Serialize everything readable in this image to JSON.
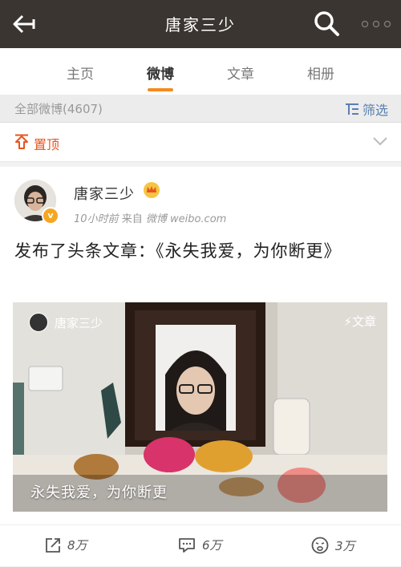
{
  "header": {
    "title": "唐家三少"
  },
  "tabs": [
    {
      "label": "主页"
    },
    {
      "label": "微博"
    },
    {
      "label": "文章"
    },
    {
      "label": "相册"
    }
  ],
  "filterbar": {
    "count_label": "全部微博(4607)",
    "filter_label": "筛选"
  },
  "pinned": {
    "label": "置顶"
  },
  "post": {
    "author": "唐家三少",
    "time": "10小时前",
    "source_prefix": "来自",
    "source": "微博 weibo.com",
    "text": "发布了头条文章：《永失我爱，为你断更》",
    "article": {
      "author": "唐家三少",
      "tag": "文章",
      "title": "永失我爱，为你断更"
    },
    "actions": {
      "share": "8万",
      "comment": "6万",
      "like": "3万"
    }
  },
  "colors": {
    "header_bg": "#3a3530",
    "accent": "#f58a1f",
    "pin_red": "#e8541e",
    "link_blue": "#5a7fb0"
  },
  "icons": [
    "back-arrow-icon",
    "search-icon",
    "more-icon",
    "pin-icon",
    "chevron-down-icon",
    "crown-icon",
    "share-icon",
    "comment-icon",
    "like-icon"
  ]
}
